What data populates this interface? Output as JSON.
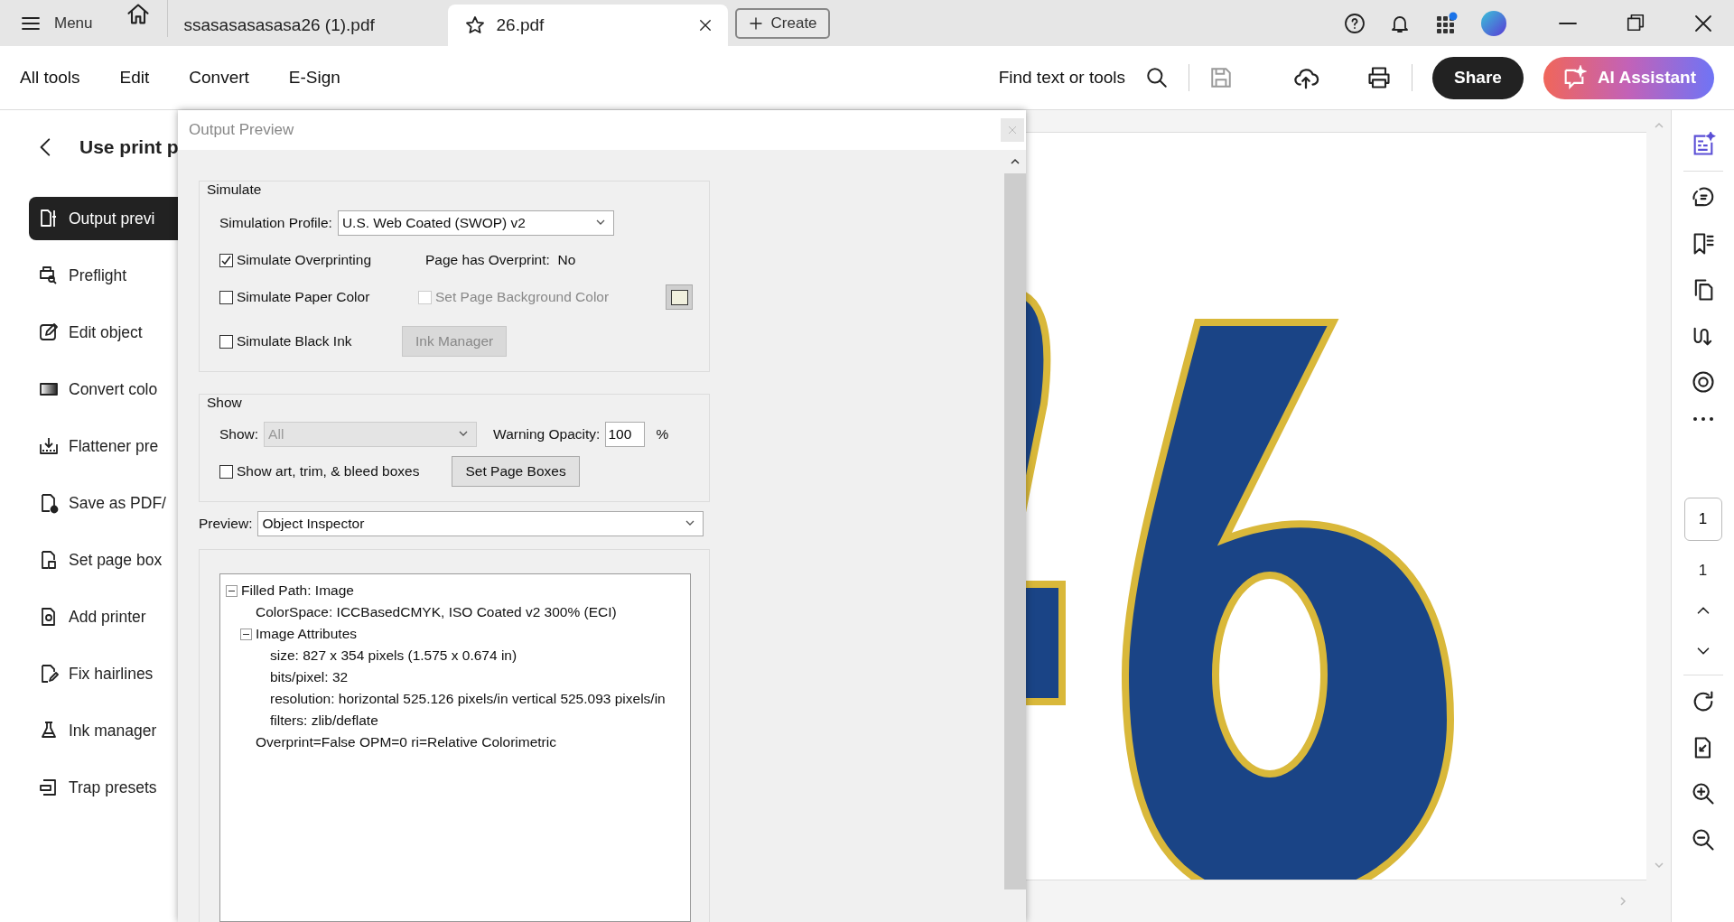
{
  "top_bar": {
    "menu_label": "Menu",
    "tabs": [
      {
        "label": "ssasasasasasa26 (1).pdf",
        "selected": false
      },
      {
        "label": "26.pdf",
        "selected": true
      }
    ],
    "create_label": "Create"
  },
  "toolbar": {
    "items": [
      "All tools",
      "Edit",
      "Convert",
      "E-Sign"
    ],
    "search_label": "Find text or tools",
    "share_label": "Share",
    "ai_label": "AI Assistant"
  },
  "left_panel": {
    "title": "Use print p",
    "items": [
      {
        "label": "Output previ",
        "selected": true
      },
      {
        "label": "Preflight",
        "selected": false
      },
      {
        "label": "Edit object",
        "selected": false
      },
      {
        "label": "Convert colo",
        "selected": false
      },
      {
        "label": "Flattener pre",
        "selected": false
      },
      {
        "label": "Save as PDF/",
        "selected": false
      },
      {
        "label": "Set page box",
        "selected": false
      },
      {
        "label": "Add printer",
        "selected": false
      },
      {
        "label": "Fix hairlines",
        "selected": false
      },
      {
        "label": "Ink manager",
        "selected": false
      },
      {
        "label": "Trap presets",
        "selected": false
      }
    ]
  },
  "dialog": {
    "title": "Output Preview",
    "simulate": {
      "legend": "Simulate",
      "profile_label": "Simulation Profile:",
      "profile_value": "U.S. Web Coated (SWOP) v2",
      "overprinting": {
        "label": "Simulate Overprinting",
        "checked": true
      },
      "overprint_label": "Page has Overprint:",
      "overprint_value": "No",
      "paper_color": {
        "label": "Simulate Paper Color",
        "checked": false
      },
      "page_background": {
        "label": "Set Page Background Color",
        "checked": false,
        "disabled": true
      },
      "black_ink": {
        "label": "Simulate Black Ink",
        "checked": false
      },
      "ink_manager": {
        "label": "Ink Manager",
        "disabled": true
      }
    },
    "show": {
      "legend": "Show",
      "show_label": "Show:",
      "show_value": "All",
      "show_disabled": true,
      "opacity_label": "Warning Opacity:",
      "opacity_value": "100",
      "percent": "%",
      "boxes": {
        "label": "Show art, trim, & bleed boxes",
        "checked": false
      },
      "set_boxes_label": "Set Page Boxes"
    },
    "preview": {
      "label": "Preview:",
      "value": "Object Inspector"
    },
    "inspector": [
      {
        "label": "Filled Path: Image",
        "expanded": true,
        "children": [
          {
            "label": "ColorSpace: ICCBasedCMYK, ISO Coated v2 300% (ECI)"
          },
          {
            "label": "Image Attributes",
            "expanded": true,
            "children": [
              {
                "label": "size: 827 x 354 pixels (1.575 x 0.674 in)"
              },
              {
                "label": "bits/pixel: 32"
              },
              {
                "label": "resolution: horizontal 525.126 pixels/in vertical 525.093 pixels/in"
              },
              {
                "label": "filters: zlib/deflate"
              }
            ]
          },
          {
            "label": "Overprint=False OPM=0 ri=Relative Colorimetric"
          }
        ]
      }
    ]
  },
  "document": {
    "page_input": "1",
    "page_total": "1"
  }
}
